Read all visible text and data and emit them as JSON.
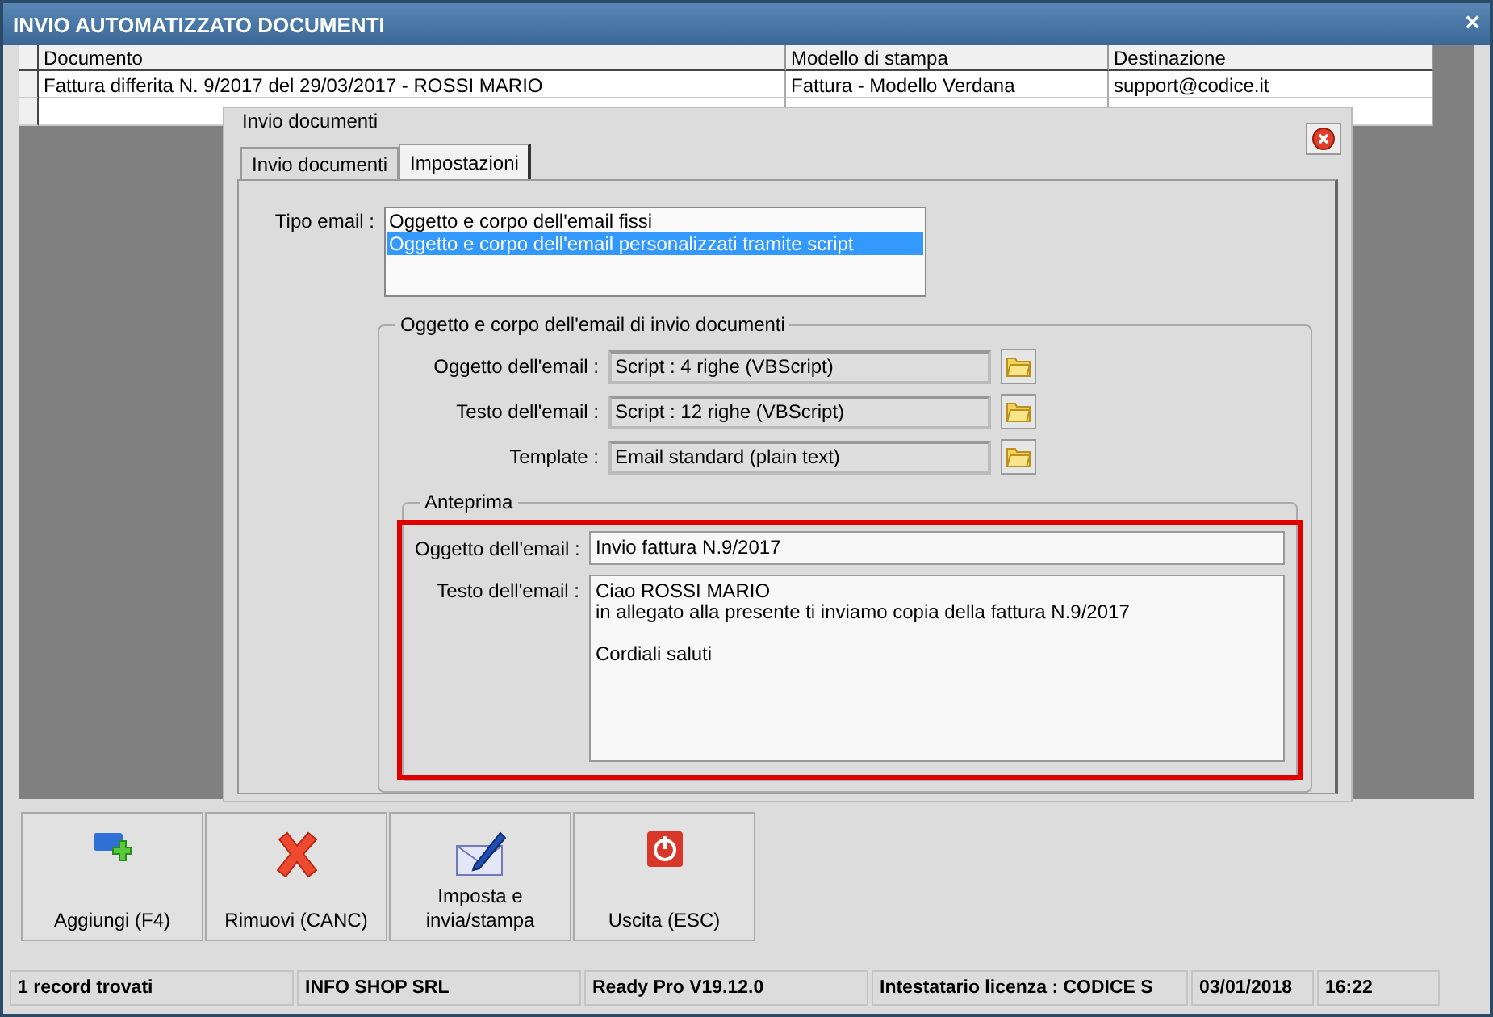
{
  "window": {
    "title": "INVIO AUTOMATIZZATO DOCUMENTI",
    "close": "×"
  },
  "table": {
    "columns": [
      "Documento",
      "Modello di stampa",
      "Destinazione"
    ],
    "rows": [
      [
        "Fattura differita N. 9/2017 del 29/03/2017 - ROSSI MARIO",
        "Fattura - Modello Verdana",
        "support@codice.it"
      ]
    ]
  },
  "dialog": {
    "title": "Invio documenti",
    "tabs": [
      {
        "label": "Invio documenti",
        "selected": false
      },
      {
        "label": "Impostazioni",
        "selected": true
      }
    ],
    "tipo_email": {
      "label": "Tipo email :",
      "options": [
        {
          "label": "Oggetto e corpo dell'email fissi",
          "selected": false
        },
        {
          "label": "Oggetto e corpo dell'email personalizzati tramite script",
          "selected": true
        }
      ]
    },
    "script_group": {
      "title": "Oggetto e corpo dell'email di invio documenti",
      "fields": [
        {
          "label": "Oggetto dell'email :",
          "value": "Script : 4 righe (VBScript)"
        },
        {
          "label": "Testo dell'email :",
          "value": "Script : 12 righe (VBScript)"
        },
        {
          "label": "Template :",
          "value": "Email standard (plain text)"
        }
      ]
    },
    "preview": {
      "title": "Anteprima",
      "subject": {
        "label": "Oggetto dell'email :",
        "value": "Invio fattura N.9/2017"
      },
      "body": {
        "label": "Testo dell'email :",
        "value": "Ciao ROSSI MARIO\nin allegato alla presente ti inviamo copia della fattura N.9/2017\n\nCordiali saluti"
      }
    }
  },
  "buttons": [
    {
      "label": "Aggiungi (F4)",
      "kind": "add"
    },
    {
      "label": "Rimuovi (CANC)",
      "kind": "remove"
    },
    {
      "label": "Imposta e invia/stampa",
      "kind": "send"
    },
    {
      "label": "Uscita (ESC)",
      "kind": "exit"
    }
  ],
  "status_bar": [
    "1 record trovati",
    "INFO SHOP SRL",
    "Ready Pro V19.12.0",
    "Intestatario licenza : CODICE S",
    "03/01/2018",
    "16:22"
  ]
}
